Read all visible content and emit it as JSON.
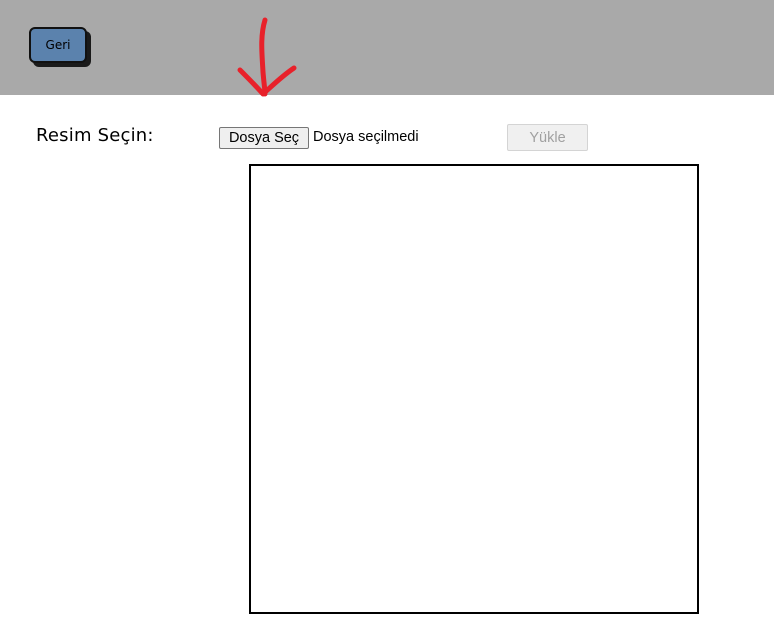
{
  "header": {
    "back_label": "Geri",
    "background": "#a9a9a9"
  },
  "annotation": {
    "icon": "red-down-arrow",
    "color": "#e8212a"
  },
  "form": {
    "label": "Resim Seçin:",
    "file_button_label": "Dosya Seç",
    "file_status": "Dosya seçilmedi",
    "upload_label": "Yükle",
    "upload_disabled": true
  },
  "preview": {
    "icon": "image-preview-box"
  }
}
